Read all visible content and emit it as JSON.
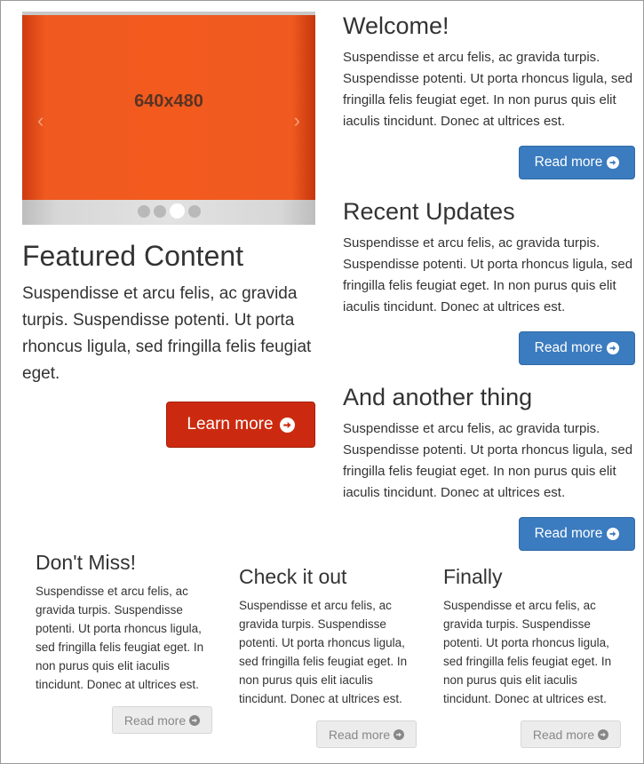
{
  "carousel": {
    "slide_label": "640x480",
    "prev_glyph": "‹",
    "next_glyph": "›",
    "indicators": 4,
    "active_index": 2,
    "color": "#f05a20"
  },
  "featured": {
    "title": "Featured Content",
    "text": "Suspendisse et arcu felis, ac gravida turpis. Suspendisse potenti. Ut porta rhoncus ligula, sed fringilla felis feugiat eget.",
    "button_label": "Learn more",
    "button_icon": "circle-arrow-right-icon",
    "button_color": "#cc2a10"
  },
  "right_sections": [
    {
      "title": "Welcome!",
      "text": "Suspendisse et arcu felis, ac gravida turpis. Suspendisse potenti. Ut porta rhoncus ligula, sed fringilla felis feugiat eget. In non purus quis elit iaculis tincidunt. Donec at ultrices est.",
      "button_label": "Read more"
    },
    {
      "title": "Recent Updates",
      "text": "Suspendisse et arcu felis, ac gravida turpis. Suspendisse potenti. Ut porta rhoncus ligula, sed fringilla felis feugiat eget. In non purus quis elit iaculis tincidunt. Donec at ultrices est.",
      "button_label": "Read more"
    },
    {
      "title": "And another thing",
      "text": "Suspendisse et arcu felis, ac gravida turpis. Suspendisse potenti. Ut porta rhoncus ligula, sed fringilla felis feugiat eget. In non purus quis elit iaculis tincidunt. Donec at ultrices est.",
      "button_label": "Read more"
    }
  ],
  "bottom_sections": [
    {
      "title": "Don't Miss!",
      "text": "Suspendisse et arcu felis, ac gravida turpis. Suspendisse potenti. Ut porta rhoncus ligula, sed fringilla felis feugiat eget. In non purus quis elit iaculis tincidunt. Donec at ultrices est.",
      "button_label": "Read more"
    },
    {
      "title": "Check it out",
      "text": "Suspendisse et arcu felis, ac gravida turpis. Suspendisse potenti. Ut porta rhoncus ligula, sed fringilla felis feugiat eget. In non purus quis elit iaculis tincidunt. Donec at ultrices est.",
      "button_label": "Read more"
    },
    {
      "title": "Finally",
      "text": "Suspendisse et arcu felis, ac gravida turpis. Suspendisse potenti. Ut porta rhoncus ligula, sed fringilla felis feugiat eget. In non purus quis elit iaculis tincidunt. Donec at ultrices est.",
      "button_label": "Read more"
    }
  ],
  "colors": {
    "primary": "#3b7bbf",
    "danger": "#cc2a10",
    "default_button": "#ececec",
    "text": "#333333"
  }
}
